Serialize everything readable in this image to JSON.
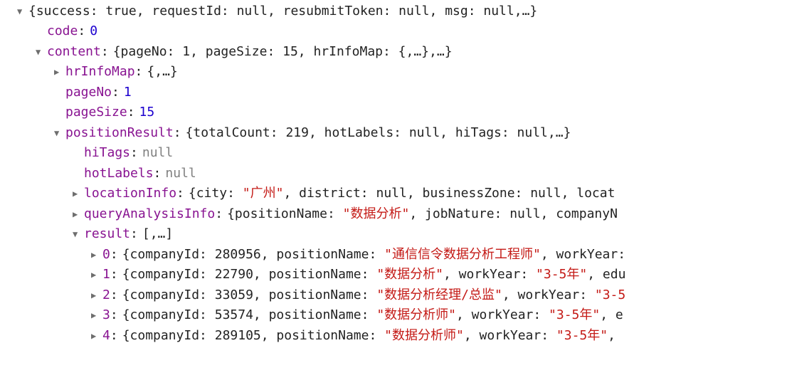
{
  "root_summary": "{success: true, requestId: null, resubmitToken: null, msg: null,…}",
  "code_key": "code",
  "code_val": "0",
  "content_key": "content",
  "content_summary": "{pageNo: 1, pageSize: 15, hrInfoMap: {,…},…}",
  "hrInfoMap_key": "hrInfoMap",
  "hrInfoMap_summary": "{,…}",
  "pageNo_key": "pageNo",
  "pageNo_val": "1",
  "pageSize_key": "pageSize",
  "pageSize_val": "15",
  "positionResult_key": "positionResult",
  "positionResult_summary": "{totalCount: 219, hotLabels: null, hiTags: null,…}",
  "hiTags_key": "hiTags",
  "hiTags_val": "null",
  "hotLabels_key": "hotLabels",
  "hotLabels_val": "null",
  "locationInfo_key": "locationInfo",
  "locationInfo_summary_pre": "{city: ",
  "locationInfo_city": "\"广州\"",
  "locationInfo_summary_post": ", district: null, businessZone: null, locat",
  "queryAnalysisInfo_key": "queryAnalysisInfo",
  "queryAnalysisInfo_summary_pre": "{positionName: ",
  "queryAnalysisInfo_posName": "\"数据分析\"",
  "queryAnalysisInfo_summary_post": ", jobNature: null, companyN",
  "result_key": "result",
  "result_summary": "[,…]",
  "r0_key": "0",
  "r0_pre": "{companyId: 280956, positionName: ",
  "r0_str": "\"通信信令数据分析工程师\"",
  "r0_post": ", workYear:",
  "r1_key": "1",
  "r1_pre": "{companyId: 22790, positionName: ",
  "r1_str": "\"数据分析\"",
  "r1_mid": ", workYear: ",
  "r1_wy": "\"3-5年\"",
  "r1_post": ", edu",
  "r2_key": "2",
  "r2_pre": "{companyId: 33059, positionName: ",
  "r2_str": "\"数据分析经理/总监\"",
  "r2_mid": ", workYear: ",
  "r2_wy": "\"3-5",
  "r3_key": "3",
  "r3_pre": "{companyId: 53574, positionName: ",
  "r3_str": "\"数据分析师\"",
  "r3_mid": ", workYear: ",
  "r3_wy": "\"3-5年\"",
  "r3_post": ", e",
  "r4_key": "4",
  "r4_pre": "{companyId: 289105, positionName: ",
  "r4_str": "\"数据分析师\"",
  "r4_mid": ", workYear: ",
  "r4_wy": "\"3-5年\"",
  "r4_post": ", "
}
